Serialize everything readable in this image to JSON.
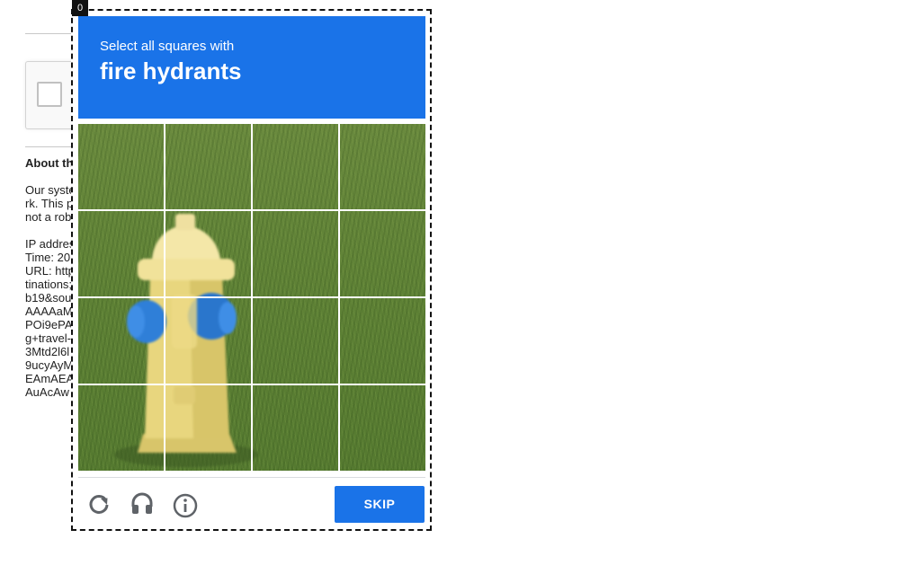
{
  "background": {
    "about_title": "About th",
    "lines": [
      "Our syste",
      "rk. This p",
      "not a rob",
      "",
      "IP addres",
      "Time: 20",
      "URL: http",
      "tinations;",
      "b19&sou",
      "AAAAaM",
      "POi9ePA",
      "g+travel-",
      "3Mtd2l6l",
      "9ucyAyM",
      "EAmAEA",
      "AuAcAw"
    ]
  },
  "challenge": {
    "corner_badge": "0",
    "instruction_prefix": "Select all squares with",
    "target_object": "fire hydrants",
    "tiles": [
      "tile-1",
      "tile-2",
      "tile-3",
      "tile-4",
      "tile-5",
      "tile-6",
      "tile-7",
      "tile-8",
      "tile-9",
      "tile-10",
      "tile-11",
      "tile-12",
      "tile-13",
      "tile-14",
      "tile-15",
      "tile-16"
    ],
    "footer": {
      "icons": [
        "reload-icon",
        "audio-icon",
        "info-icon"
      ],
      "skip_label": "SKIP"
    }
  },
  "colors": {
    "accent": "#1a73e8",
    "grass": "#5f8236",
    "hydrant_body": "#e6d27a",
    "hydrant_caps": "#2e7bd6"
  }
}
